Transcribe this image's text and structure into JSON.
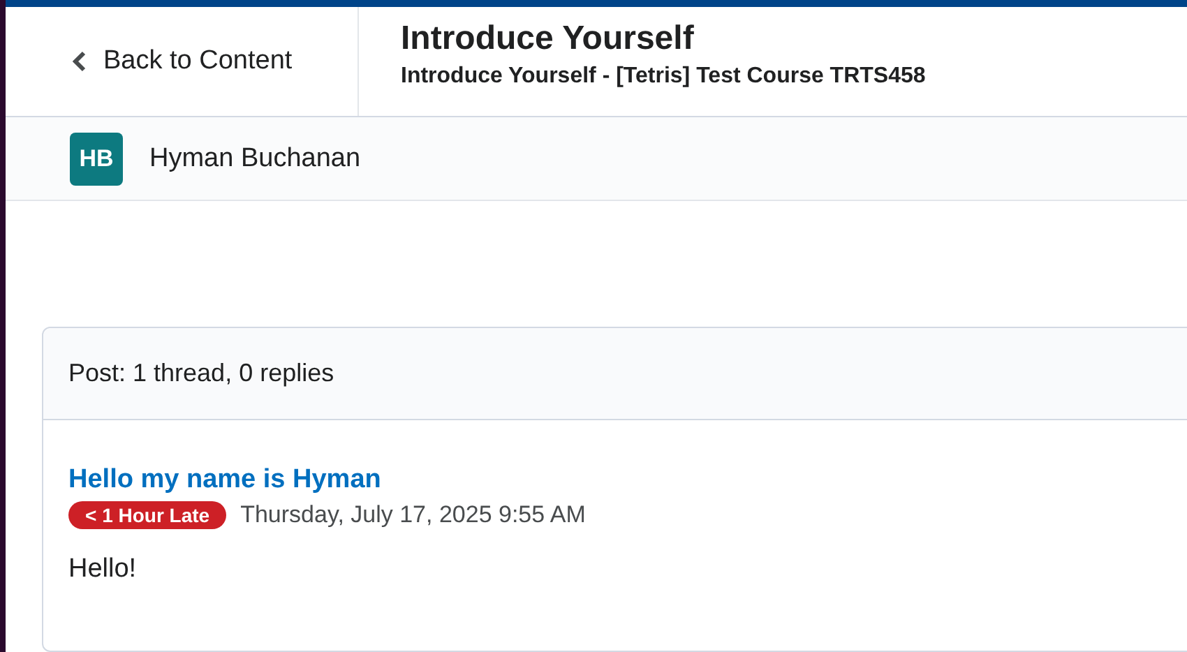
{
  "header": {
    "back_link": "Back to Content",
    "title": "Introduce Yourself",
    "subtitle": "Introduce Yourself - [Tetris] Test Course TRTS458"
  },
  "user": {
    "initials": "HB",
    "name": "Hyman Buchanan"
  },
  "card": {
    "summary": "Post: 1 thread, 0 replies",
    "posts": [
      {
        "title": "Hello my name is Hyman",
        "badge": "< 1 Hour Late",
        "date": "Thursday, July 17, 2025 9:55 AM",
        "body": "Hello!"
      }
    ]
  }
}
